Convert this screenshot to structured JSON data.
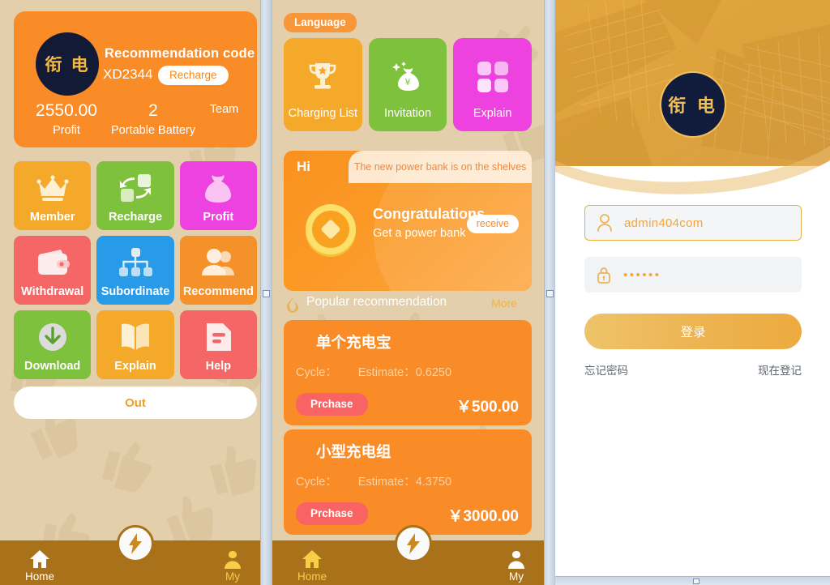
{
  "colors": {
    "beige_bg": "#e3cfac",
    "orange_card": "#fa8c28",
    "tabbar": "#a9711a",
    "accent_yellow": "#f6cf46",
    "gold": "#e0a43c"
  },
  "panel_profile": {
    "logo_text": "衔 电",
    "recommendation_label": "Recommendation code",
    "recommendation_code": "XD2344",
    "recharge_label": "Recharge",
    "stats": [
      {
        "value": "2550.00",
        "label": "Profit"
      },
      {
        "value": "2",
        "label": "Portable Battery"
      },
      {
        "value": "",
        "label": "Team"
      }
    ],
    "tiles": [
      {
        "label": "Member",
        "icon": "crown-icon",
        "color": "#f5a92b"
      },
      {
        "label": "Recharge",
        "icon": "exchange-icon",
        "color": "#7ec13c"
      },
      {
        "label": "Profit",
        "icon": "money-bag-icon",
        "color": "#ed42e0"
      },
      {
        "label": "Withdrawal",
        "icon": "wallet-icon",
        "color": "#f56767"
      },
      {
        "label": "Subordinate",
        "icon": "hierarchy-icon",
        "color": "#279ae8"
      },
      {
        "label": "Recommend",
        "icon": "users-icon",
        "color": "#f5912b"
      },
      {
        "label": "Download",
        "icon": "download-icon",
        "color": "#7ec13c"
      },
      {
        "label": "Explain",
        "icon": "book-icon",
        "color": "#f5a92b"
      },
      {
        "label": "Help",
        "icon": "document-icon",
        "color": "#f56767"
      }
    ],
    "out_button": "Out",
    "tabs": [
      {
        "label": "Home",
        "icon": "home-icon",
        "active": false
      },
      {
        "label": "My",
        "icon": "user-icon",
        "active": true
      }
    ],
    "fab_icon": "lightning-bolt-icon"
  },
  "panel_home": {
    "language_pill": "Language",
    "top_tiles": [
      {
        "label": "Charging List",
        "icon": "trophy-icon",
        "color": "#f5a92b"
      },
      {
        "label": "Invitation",
        "icon": "money-bag-icon",
        "color": "#7ec13c"
      },
      {
        "label": "Explain",
        "icon": "four-squares-icon",
        "color": "#ed42e0"
      }
    ],
    "promo": {
      "hi": "Hi",
      "notice": "The new power bank is on the shelves",
      "title": "Congratulations",
      "subtitle": "Get a power bank",
      "button": "receive",
      "coin_icon": "gold-coin-icon"
    },
    "section": {
      "icon": "fire-icon",
      "title": "Popular recommendation",
      "more": "More"
    },
    "products": [
      {
        "name": "单个充电宝",
        "cycle_label": "Cycle：",
        "estimate_label": "Estimate：",
        "estimate_value": "0.6250",
        "buy_label": "Prchase",
        "price": "￥500.00"
      },
      {
        "name": "小型充电组",
        "cycle_label": "Cycle：",
        "estimate_label": "Estimate：",
        "estimate_value": "4.3750",
        "buy_label": "Prchase",
        "price": "￥3000.00"
      }
    ],
    "tabs": [
      {
        "label": "Home",
        "icon": "home-icon",
        "active": true
      },
      {
        "label": "My",
        "icon": "user-icon",
        "active": false
      }
    ],
    "fab_icon": "lightning-bolt-icon"
  },
  "panel_login": {
    "logo_text": "衔 电",
    "username": {
      "value": "admin404com",
      "placeholder": "admin404com",
      "icon": "person-icon"
    },
    "password": {
      "value": "••••••",
      "icon": "lock-icon"
    },
    "submit_label": "登录",
    "forgot_label": "忘记密码",
    "register_label": "现在登记"
  }
}
